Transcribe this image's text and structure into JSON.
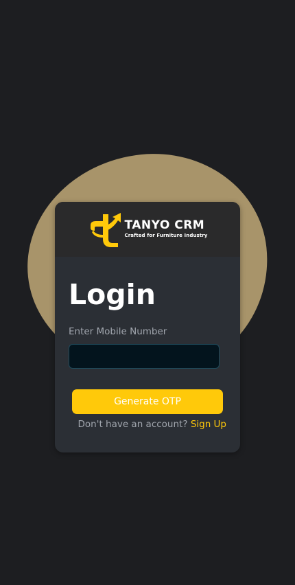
{
  "brand": {
    "name": "TANYO CRM",
    "tagline": "Crafted for Furniture Industry",
    "accent_color": "#ffc90a",
    "logo_icon": "tanyo-t-arrow-logo"
  },
  "login": {
    "title": "Login",
    "mobile_label": "Enter Mobile Number",
    "mobile_value": "",
    "mobile_placeholder": "",
    "generate_otp_label": "Generate OTP",
    "signup_prompt": "Don't have an account?",
    "signup_link": "Sign Up"
  },
  "colors": {
    "background": "#1d1e21",
    "blob": "#a8946a",
    "card": "#2b2f35",
    "input_bg": "#03141d",
    "button": "#ffc90a"
  }
}
